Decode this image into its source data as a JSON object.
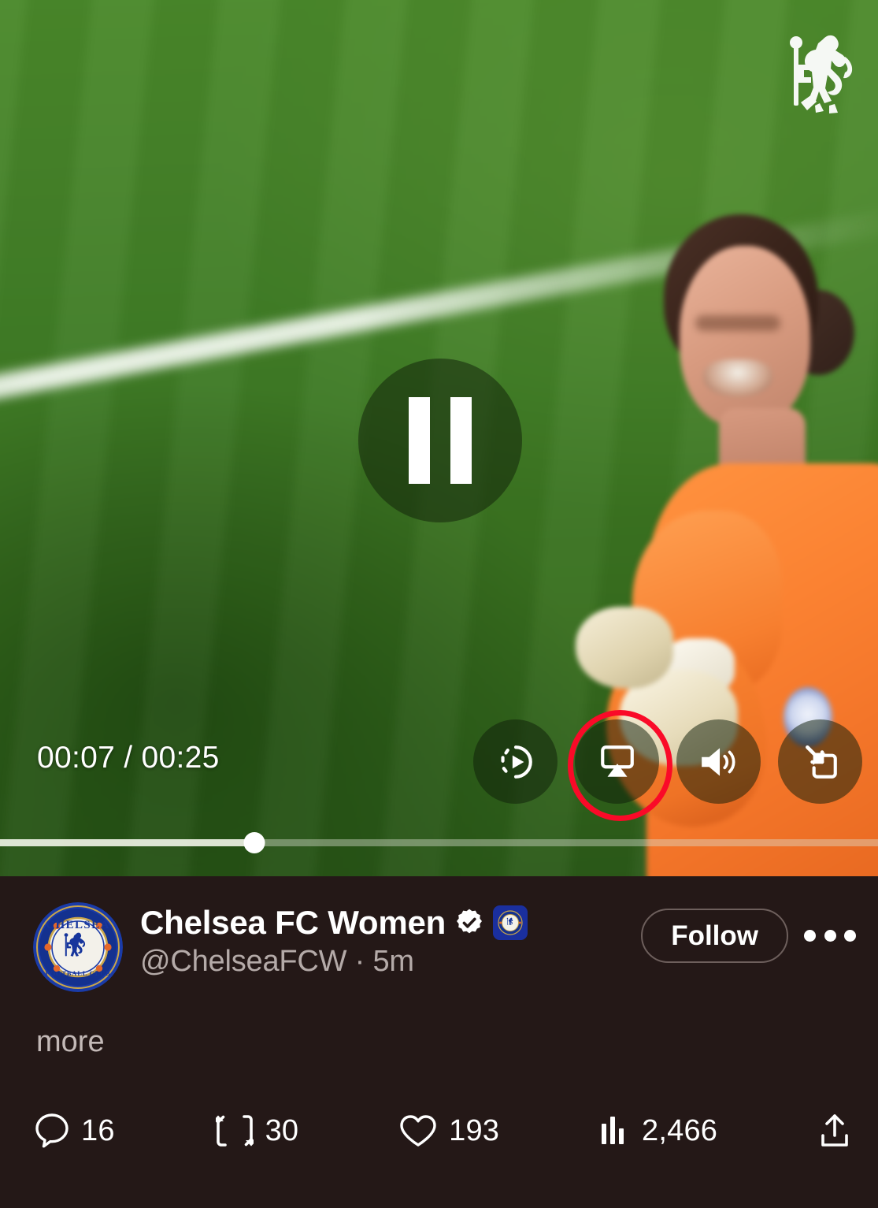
{
  "video": {
    "state": "playing",
    "pause_button": "pause-button",
    "current_time": "00:07",
    "duration": "00:25",
    "timestamp_label": "00:07 / 00:25",
    "progress_percent": 29,
    "watermark": "chelsea-lion-watermark",
    "scene_description": "goalkeeper-celebrating-on-pitch",
    "controls": [
      {
        "name": "replay-autoplay-button",
        "icon": "replay-icon",
        "highlighted": false
      },
      {
        "name": "cast-button",
        "icon": "airplay-cast-icon",
        "highlighted": true
      },
      {
        "name": "volume-button",
        "icon": "volume-on-icon",
        "highlighted": false
      },
      {
        "name": "picture-in-picture-button",
        "icon": "picture-in-picture-icon",
        "highlighted": false
      }
    ],
    "highlight_color": "#fa0a28"
  },
  "post": {
    "avatar": "chelsea-fc-crest-avatar",
    "display_name": "Chelsea FC Women",
    "verified": true,
    "verified_badge_color": "#ffffff",
    "affiliate_badge": "chelsea-fc-affiliate-badge",
    "affiliate_badge_color": "#1a2f9e",
    "handle_line": "@ChelseaFCW · 5m",
    "handle": "@ChelseaFCW",
    "time_ago": "5m",
    "follow_label": "Follow",
    "more_menu": "more-options",
    "more_link": "more",
    "background_color": "#241817"
  },
  "engagement": [
    {
      "name": "reply",
      "icon": "reply-icon",
      "count": "16"
    },
    {
      "name": "repost",
      "icon": "repost-icon",
      "count": "30"
    },
    {
      "name": "like",
      "icon": "heart-icon",
      "count": "193"
    },
    {
      "name": "views",
      "icon": "analytics-bars-icon",
      "count": "2,466"
    },
    {
      "name": "share",
      "icon": "share-up-icon",
      "count": ""
    }
  ]
}
